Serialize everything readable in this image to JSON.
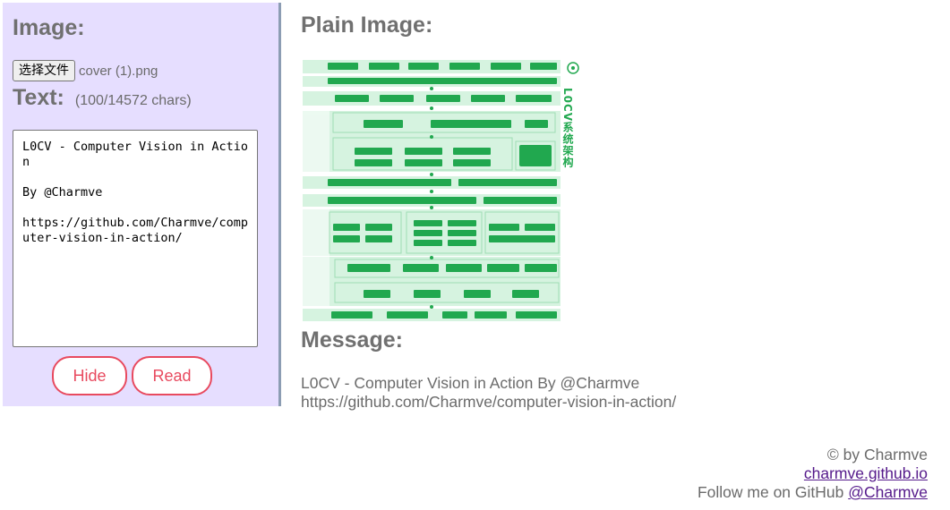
{
  "sidebar": {
    "image_heading": "Image:",
    "file_button_label": "选择文件",
    "file_name": "cover (1).png",
    "text_heading": "Text:",
    "char_count": "(100/14572 chars)",
    "text_value": "L0CV - Computer Vision in Action\n\nBy @Charmve\n\nhttps://github.com/Charmve/computer-vision-in-action/",
    "hide_label": "Hide",
    "read_label": "Read"
  },
  "main": {
    "plain_image_heading": "Plain Image:",
    "message_heading": "Message:",
    "message_line1": "L0CV - Computer Vision in Action By @Charmve",
    "message_line2": "https://github.com/Charmve/computer-vision-in-action/",
    "image_vertical_title": "L0CV系统架构"
  },
  "footer": {
    "copyright": "© by Charmve",
    "site_link": "charmve.github.io",
    "follow_text": "Follow me on GitHub ",
    "github_link": "@Charmve"
  },
  "colors": {
    "sidebar_bg": "#e6deff",
    "button_accent": "#e84a5f",
    "diagram_green": "#21a84f",
    "diagram_bg": "#d6f3e0"
  }
}
